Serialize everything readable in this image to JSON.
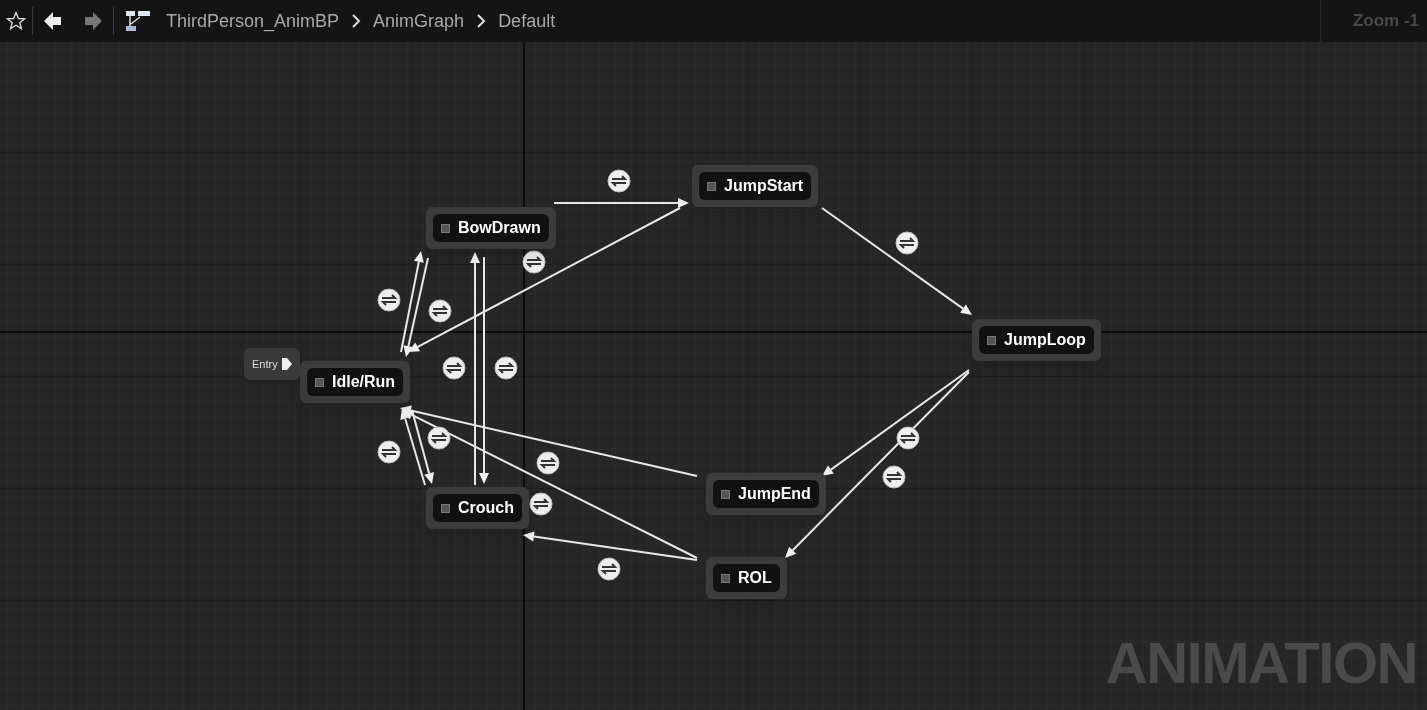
{
  "toolbar": {
    "back": {
      "disabled": false
    },
    "forward": {
      "disabled": true
    },
    "breadcrumbs": [
      "ThirdPerson_AnimBP",
      "AnimGraph",
      "Default"
    ],
    "zoom_label": "Zoom -1"
  },
  "graph": {
    "nodes": [
      {
        "kind": "entry",
        "label": "Entry"
      },
      {
        "kind": "state",
        "label": "Idle/Run"
      },
      {
        "kind": "state",
        "label": "BowDrawn"
      },
      {
        "kind": "state",
        "label": "Crouch"
      },
      {
        "kind": "state",
        "label": "JumpStart"
      },
      {
        "kind": "state",
        "label": "JumpLoop"
      },
      {
        "kind": "state",
        "label": "JumpEnd"
      },
      {
        "kind": "state",
        "label": "ROL"
      }
    ],
    "graph_type_label": "ANIMATION"
  }
}
